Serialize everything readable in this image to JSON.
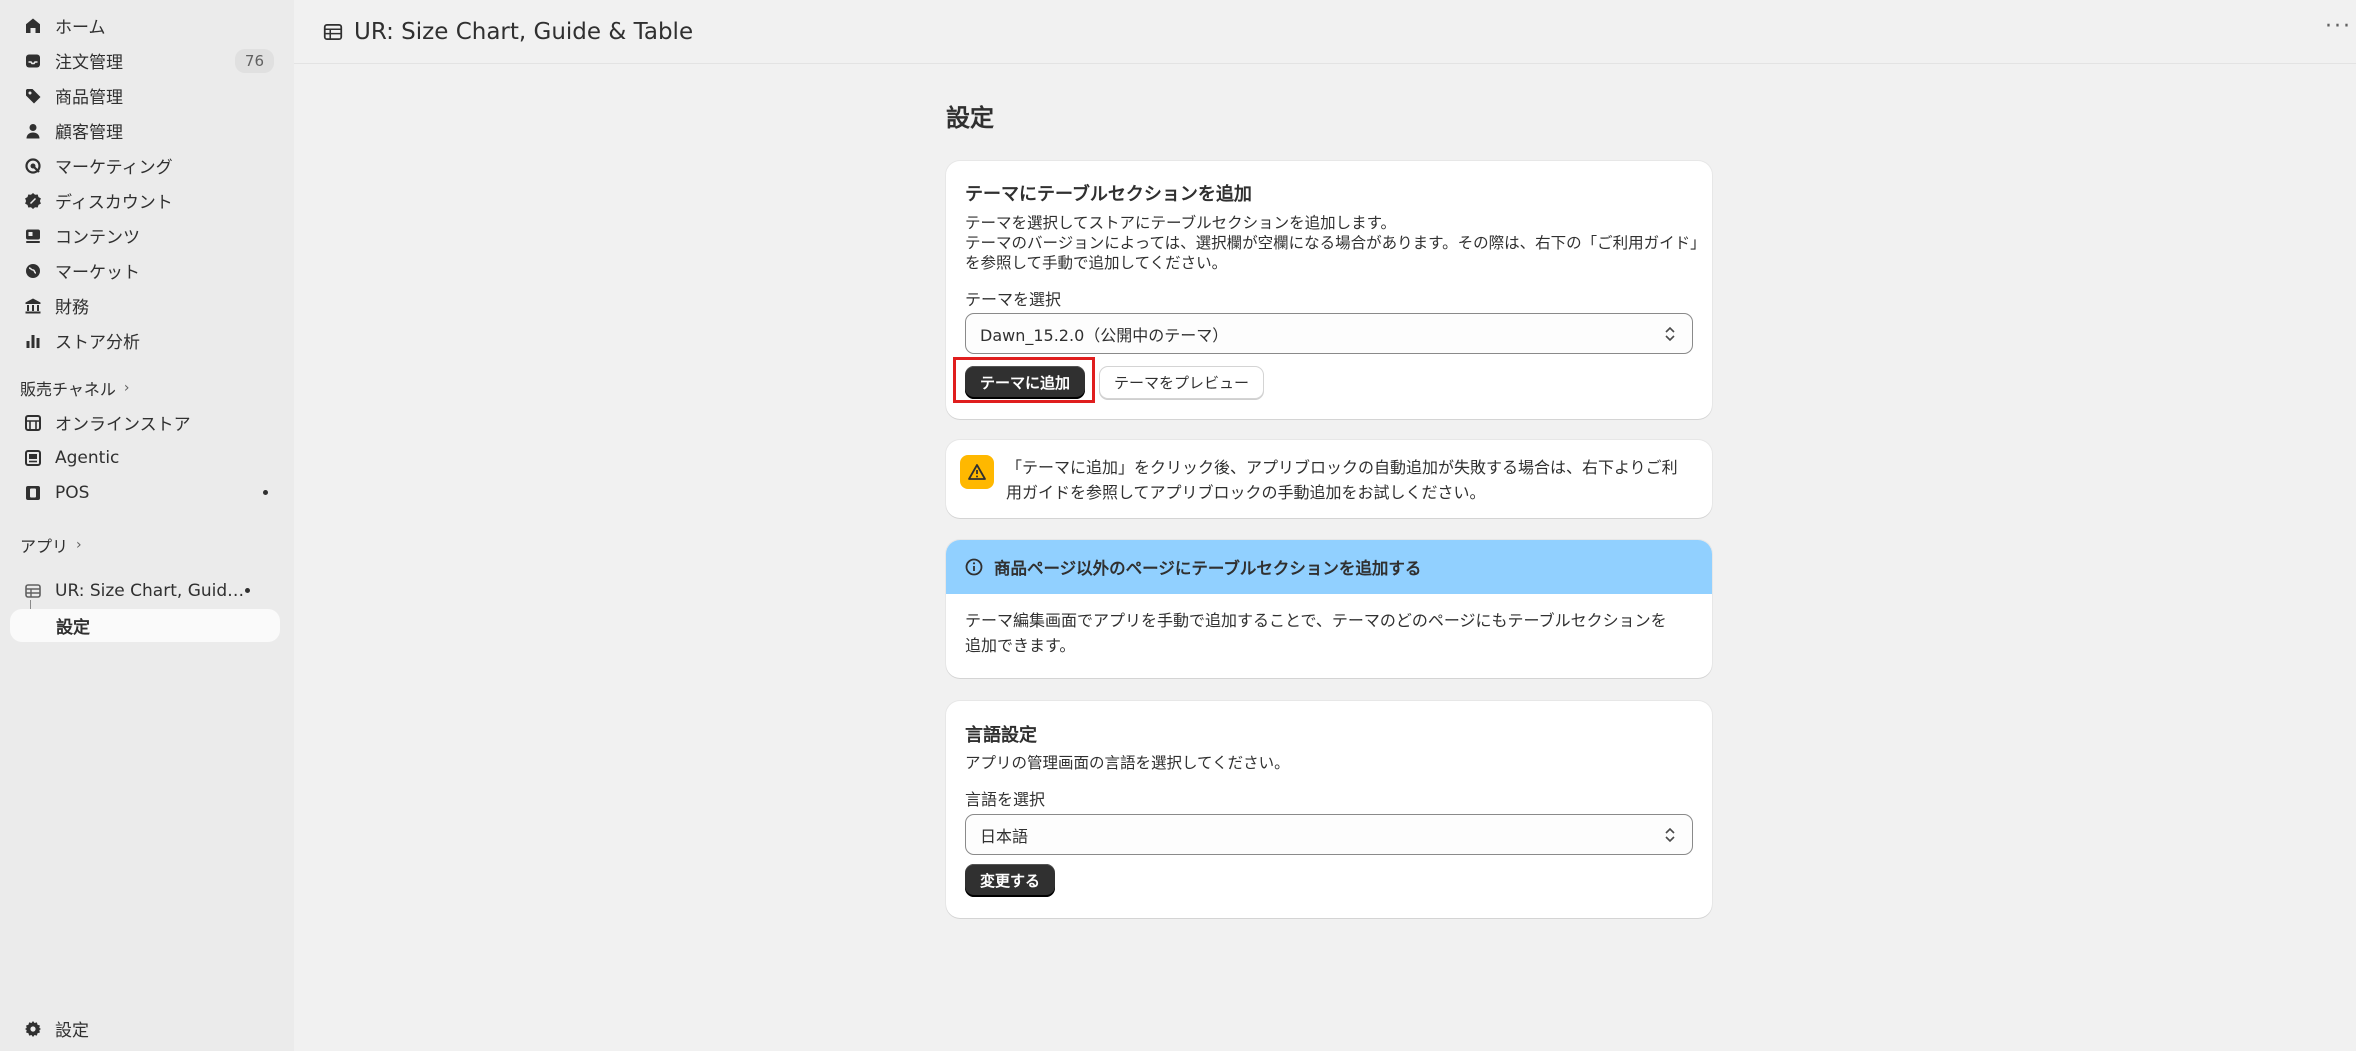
{
  "sidebar": {
    "items": [
      {
        "label": "ホーム",
        "icon": "home-icon"
      },
      {
        "label": "注文管理",
        "icon": "inbox-icon",
        "badge": "76"
      },
      {
        "label": "商品管理",
        "icon": "tag-icon"
      },
      {
        "label": "顧客管理",
        "icon": "person-icon"
      },
      {
        "label": "マーケティング",
        "icon": "target-icon"
      },
      {
        "label": "ディスカウント",
        "icon": "discount-icon"
      },
      {
        "label": "コンテンツ",
        "icon": "content-icon"
      },
      {
        "label": "マーケット",
        "icon": "globe-icon"
      },
      {
        "label": "財務",
        "icon": "bank-icon"
      },
      {
        "label": "ストア分析",
        "icon": "bar-chart-icon"
      }
    ],
    "sales_channels": {
      "heading": "販売チャネル",
      "items": [
        {
          "label": "オンラインストア",
          "icon": "store-icon"
        },
        {
          "label": "Agentic",
          "icon": "agentic-icon"
        },
        {
          "label": "POS",
          "icon": "pos-icon"
        }
      ]
    },
    "apps": {
      "heading": "アプリ",
      "app_label": "UR: Size Chart, Guide & Table",
      "sub_item": "設定"
    },
    "settings_label": "設定"
  },
  "header": {
    "title": "UR: Size Chart, Guide & Table"
  },
  "main": {
    "page_title": "設定",
    "theme_card": {
      "title": "テーマにテーブルセクションを追加",
      "desc_lines": [
        "テーマを選択してストアにテーブルセクションを追加します。",
        "テーマのバージョンによっては、選択欄が空欄になる場合があります。その際は、右下の「ご利用ガイド」",
        "を参照して手動で追加してください。"
      ],
      "select_label": "テーマを選択",
      "select_value": "Dawn_15.2.0（公開中のテーマ）",
      "add_button": "テーマに追加",
      "preview_button": "テーマをプレビュー"
    },
    "warning": {
      "lines": [
        "「テーマに追加」をクリック後、アプリブロックの自動追加が失敗する場合は、右下よりご利",
        "用ガイドを参照してアプリブロックの手動追加をお試しください。"
      ]
    },
    "info_card": {
      "title": "商品ページ以外のページにテーブルセクションを追加する",
      "lines": [
        "テーマ編集画面でアプリを手動で追加することで、テーマのどのページにもテーブルセクションを",
        "追加できます。"
      ]
    },
    "language_card": {
      "title": "言語設定",
      "desc": "アプリの管理画面の言語を選択してください。",
      "select_label": "言語を選択",
      "select_value": "日本語",
      "change_button": "変更する"
    }
  },
  "colors": {
    "sidebar_bg": "#ebebeb",
    "page_bg": "#f1f1f1",
    "primary_button": "#303030",
    "info_banner": "#91d0ff",
    "warning": "#ffb800",
    "highlight": "#e01e1e"
  }
}
